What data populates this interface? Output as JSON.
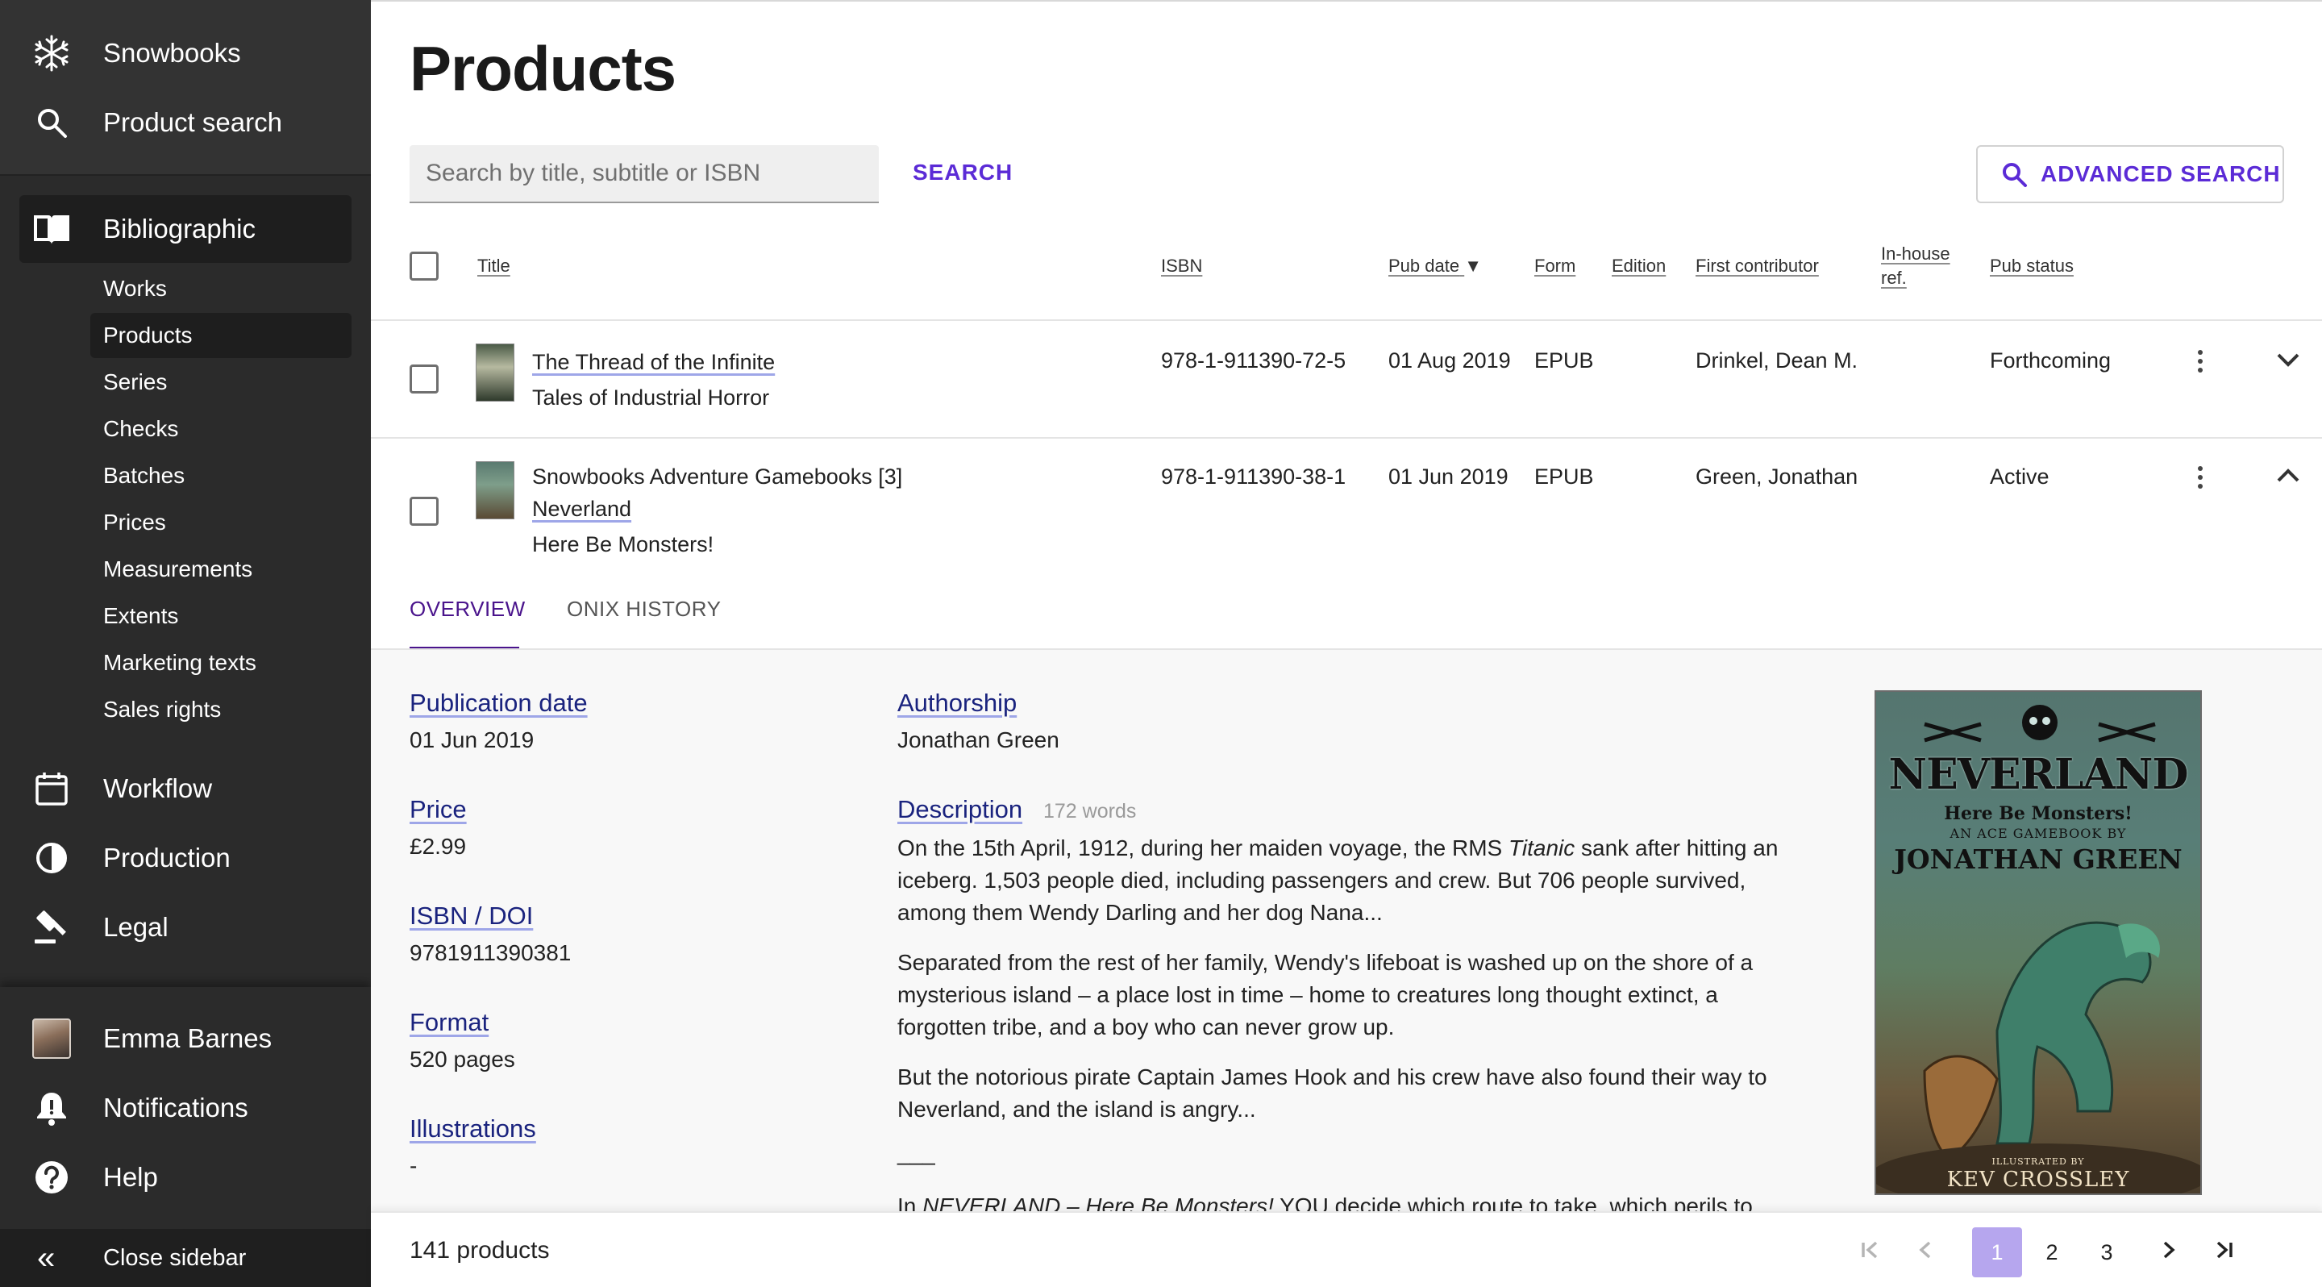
{
  "sidebar": {
    "brand": "Snowbooks",
    "product_search": "Product search",
    "sections": {
      "bibliographic": "Bibliographic",
      "workflow": "Workflow",
      "production": "Production",
      "legal": "Legal"
    },
    "sub_items": [
      "Works",
      "Products",
      "Series",
      "Checks",
      "Batches",
      "Prices",
      "Measurements",
      "Extents",
      "Marketing texts",
      "Sales rights"
    ],
    "active_sub_item": "Products",
    "user_name": "Emma Barnes",
    "notifications": "Notifications",
    "help": "Help",
    "close_sidebar": "Close sidebar",
    "close_icon_glyph": "«"
  },
  "main": {
    "title": "Products",
    "search": {
      "placeholder": "Search by title, subtitle or ISBN",
      "button": "SEARCH",
      "advanced": "ADVANCED SEARCH"
    },
    "columns": {
      "title": "Title",
      "isbn": "ISBN",
      "pub_date": "Pub date",
      "sort_indicator": "▼",
      "form": "Form",
      "edition": "Edition",
      "first_contributor": "First contributor",
      "in_house_ref_1": "In-house",
      "in_house_ref_2": "ref.",
      "pub_status": "Pub status"
    },
    "rows": [
      {
        "title": "The Thread of the Infinite",
        "subtitle": "Tales of Industrial Horror",
        "isbn": "978-1-911390-72-5",
        "pub_date": "01 Aug 2019",
        "form": "EPUB",
        "first_contributor": "Drinkel, Dean M.",
        "pub_status": "Forthcoming"
      },
      {
        "series": "Snowbooks Adventure Gamebooks [3]",
        "title": "Neverland",
        "subtitle": "Here Be Monsters!",
        "isbn": "978-1-911390-38-1",
        "pub_date": "01 Jun 2019",
        "form": "EPUB",
        "first_contributor": "Green, Jonathan",
        "pub_status": "Active"
      }
    ],
    "detail": {
      "tabs": [
        "OVERVIEW",
        "ONIX HISTORY"
      ],
      "active_tab": "OVERVIEW",
      "publication_date_label": "Publication date",
      "publication_date": "01 Jun 2019",
      "price_label": "Price",
      "price": "£2.99",
      "isbn_doi_label": "ISBN / DOI",
      "isbn_doi": "9781911390381",
      "format_label": "Format",
      "format": "520 pages",
      "illustrations_label": "Illustrations",
      "illustrations": "-",
      "authorship_label": "Authorship",
      "authorship": "Jonathan Green",
      "description_label": "Description",
      "description_words": "172 words",
      "description_p1_a": "On the 15th April, 1912, during her maiden voyage, the RMS ",
      "description_p1_em": "Titanic",
      "description_p1_b": " sank after hitting an iceberg. 1,503 people died, including passengers and crew. But 706 people survived, among them Wendy Darling and her dog Nana...",
      "description_p2": "Separated from the rest of her family, Wendy's lifeboat is washed up on the shore of a mysterious island – a place lost in time – home to creatures long thought extinct, a forgotten tribe, and a boy who can never grow up.",
      "description_p3": "But the notorious pirate Captain James Hook and his crew have also found their way to Neverland, and the island is angry...",
      "description_sep": "___",
      "description_p4_a": "In ",
      "description_p4_em": "NEVERLAND – Here Be Monsters!",
      "description_p4_b": " YOU decide which route to take, which perils to",
      "cover": {
        "title": "NEVERLAND",
        "subtitle": "Here Be Monsters!",
        "tagline": "AN ACE GAMEBOOK BY",
        "author": "JONATHAN GREEN",
        "illustrated_by": "ILLUSTRATED BY",
        "illustrator": "KEV CROSSLEY"
      }
    }
  },
  "footer": {
    "count": "141 products",
    "pages": [
      "1",
      "2",
      "3"
    ],
    "current_page": "1"
  },
  "colors": {
    "sidebar_bg": "#2b2b2b",
    "accent_purple": "#5b2bd6",
    "link_navy": "#1a237e",
    "page_active": "#b6a6ee"
  }
}
